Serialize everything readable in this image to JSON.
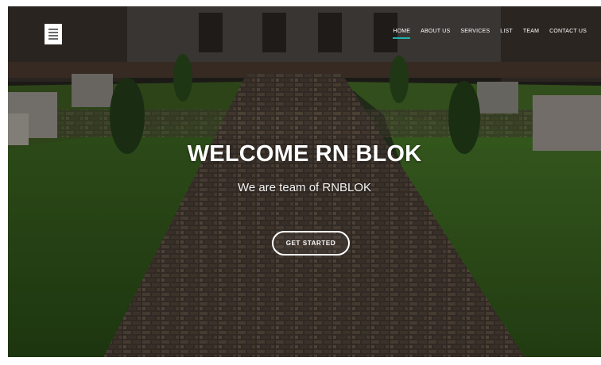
{
  "nav": {
    "logo_icon": "building-logo-icon",
    "items": [
      {
        "label": "HOME",
        "active": true
      },
      {
        "label": "ABOUT US",
        "active": false
      },
      {
        "label": "SERVICES",
        "active": false
      },
      {
        "label": "LIST",
        "active": false
      },
      {
        "label": "TEAM",
        "active": false
      },
      {
        "label": "CONTACT US",
        "active": false
      }
    ]
  },
  "hero": {
    "title": "WELCOME RN BLOK",
    "subtitle": "We are team of RNBLOK",
    "cta_label": "GET STARTED"
  },
  "colors": {
    "accent": "#20b2aa",
    "text": "#ffffff"
  }
}
